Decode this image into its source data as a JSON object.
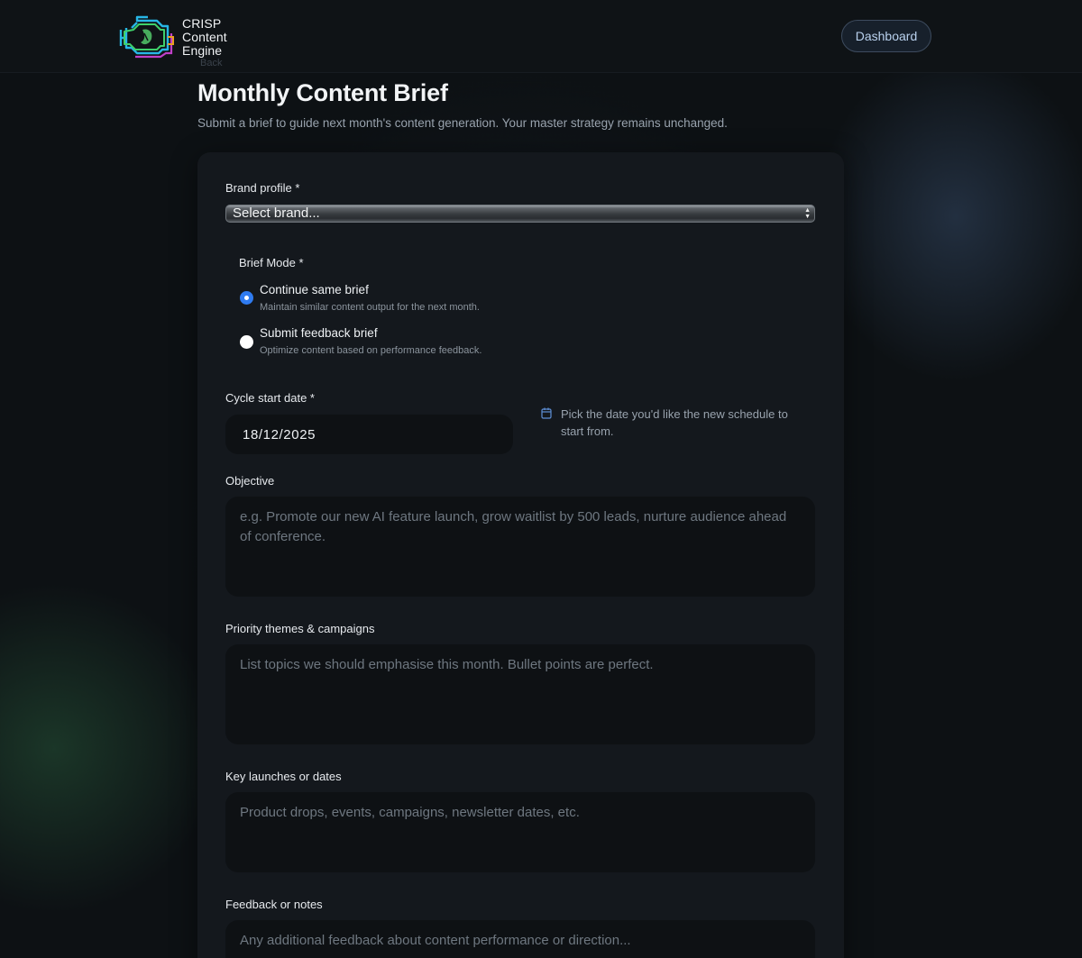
{
  "header": {
    "logo_line1": "CRISP",
    "logo_line2": "Content",
    "logo_line3": "Engine",
    "dashboard_label": "Dashboard"
  },
  "back_link": "Back",
  "page": {
    "title": "Monthly Content Brief",
    "subtitle": "Submit a brief to guide next month's content generation. Your master strategy remains unchanged."
  },
  "form": {
    "brand": {
      "label": "Brand profile *",
      "selected": "Select brand..."
    },
    "mode": {
      "label": "Brief Mode *",
      "options": [
        {
          "title": "Continue same brief",
          "desc": "Maintain similar content output for the next month.",
          "checked": true
        },
        {
          "title": "Submit feedback brief",
          "desc": "Optimize content based on performance feedback.",
          "checked": false
        }
      ]
    },
    "cycle": {
      "label": "Cycle start date *",
      "value": "18/12/2025",
      "hint": "Pick the date you'd like the new schedule to start from."
    },
    "objective": {
      "label": "Objective",
      "placeholder": "e.g. Promote our new AI feature launch, grow waitlist by 500 leads, nurture audience ahead of conference."
    },
    "themes": {
      "label": "Priority themes & campaigns",
      "placeholder": "List topics we should emphasise this month. Bullet points are perfect."
    },
    "launches": {
      "label": "Key launches or dates",
      "placeholder": "Product drops, events, campaigns, newsletter dates, etc."
    },
    "feedback": {
      "label": "Feedback or notes",
      "placeholder": "Any additional feedback about content performance or direction..."
    }
  },
  "colors": {
    "accent": "#2f7bf0",
    "background": "#0d1114",
    "card": "#14181d"
  }
}
